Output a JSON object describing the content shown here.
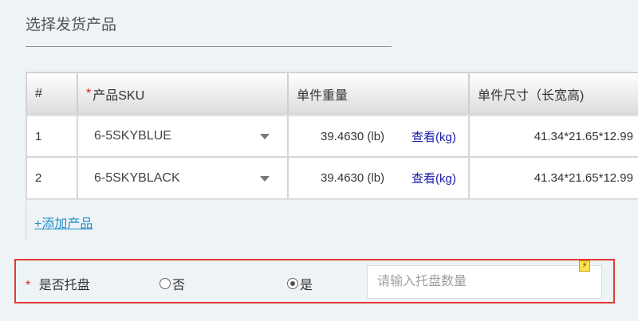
{
  "section": {
    "title": "选择发货产品"
  },
  "table": {
    "headers": {
      "index": "#",
      "sku_star": "*",
      "sku": "产品SKU",
      "weight": "单件重量",
      "size": "单件尺寸（长宽高)"
    },
    "rows": [
      {
        "index": "1",
        "sku": "6-5SKYBLUE",
        "weight": "39.4630 (lb)",
        "weight_link": "查看(kg)",
        "size": "41.34*21.65*12.99"
      },
      {
        "index": "2",
        "sku": "6-5SKYBLACK",
        "weight": "39.4630 (lb)",
        "weight_link": "查看(kg)",
        "size": "41.34*21.65*12.99"
      }
    ],
    "add_product": "+添加产品"
  },
  "pallet": {
    "required_star": "*",
    "label": "是否托盘",
    "options": [
      {
        "label": "否",
        "selected": false
      },
      {
        "label": "是",
        "selected": true
      }
    ],
    "input_placeholder": "请输入托盘数量",
    "input_value": "",
    "badge_icon": "lightning-icon",
    "highlight_color": "#e53935"
  },
  "colors": {
    "link": "#1a1aa8",
    "add_link": "#1f8fc8",
    "required": "#e02020"
  }
}
